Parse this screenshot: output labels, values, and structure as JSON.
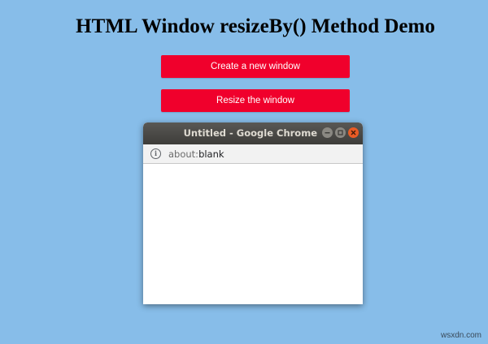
{
  "page": {
    "title": "HTML Window resizeBy() Method Demo",
    "background_color": "#87bde9"
  },
  "buttons": {
    "create_label": "Create a new window",
    "resize_label": "Resize the window",
    "color": "#f0002c"
  },
  "popup": {
    "window_title": "Untitled - Google Chrome",
    "url_scheme": "about:",
    "url_path": "blank",
    "controls": [
      "minimize-icon",
      "maximize-icon",
      "close-icon"
    ]
  },
  "watermark": "wsxdn.com"
}
